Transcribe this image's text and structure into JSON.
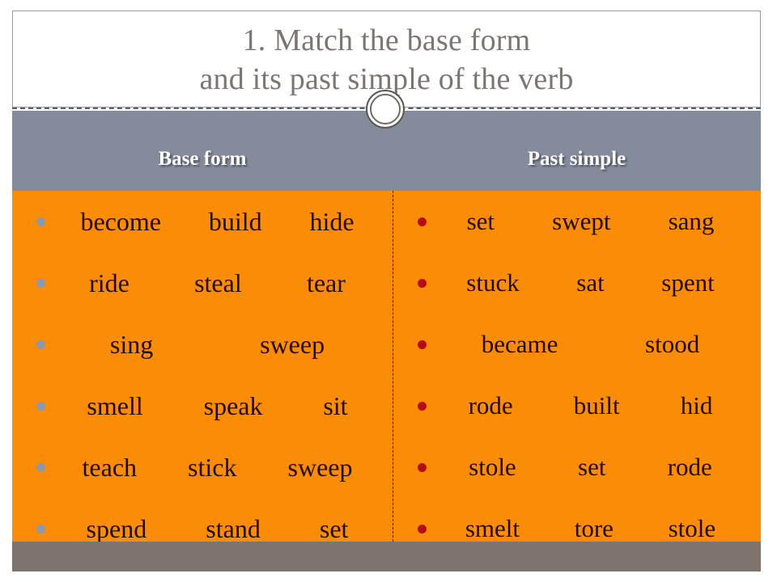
{
  "slide": {
    "title_lines": [
      "1. Match the base form",
      "and its past simple of the verb"
    ],
    "colors": {
      "title_text": "#7c7671",
      "header_band": "#848b9b",
      "content_panel": "#fb8c06",
      "footer_band": "#7d756d",
      "left_bullet": "#8c98ab",
      "right_bullet": "#b50d0d",
      "word_text": "#240a06"
    }
  },
  "columns": {
    "left": {
      "header": "Base form",
      "bullet_icon": "gray-dot-bullet",
      "rows": [
        {
          "words": [
            "become",
            "build",
            "hide"
          ]
        },
        {
          "words": [
            "ride",
            "steal",
            "tear"
          ]
        },
        {
          "words": [
            "sing",
            "sweep"
          ]
        },
        {
          "words": [
            "smell",
            "speak",
            "sit"
          ]
        },
        {
          "words": [
            "teach",
            "stick",
            "sweep"
          ]
        },
        {
          "words": [
            "spend",
            "stand",
            "set"
          ]
        }
      ]
    },
    "right": {
      "header": "Past simple",
      "bullet_icon": "red-dot-bullet",
      "rows": [
        {
          "words": [
            "set",
            "swept",
            "sang"
          ]
        },
        {
          "words": [
            "stuck",
            "sat",
            "spent"
          ]
        },
        {
          "words": [
            "became",
            "stood"
          ]
        },
        {
          "words": [
            "rode",
            "built",
            "hid"
          ]
        },
        {
          "words": [
            "stole",
            "set",
            "rode"
          ]
        },
        {
          "words": [
            "smelt",
            "tore",
            "stole"
          ]
        }
      ]
    }
  }
}
